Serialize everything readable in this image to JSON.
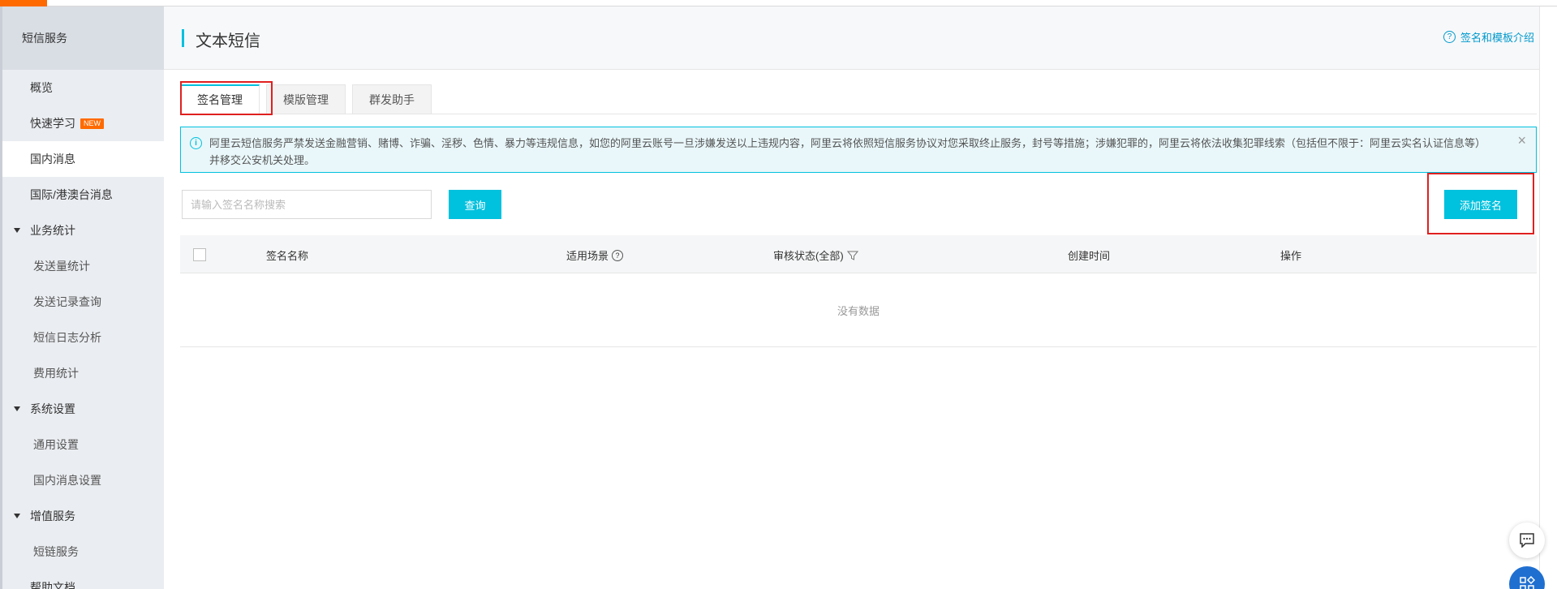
{
  "sidebar": {
    "header": "短信服务",
    "items": [
      {
        "label": "概览",
        "kind": "item"
      },
      {
        "label": "快速学习",
        "kind": "item",
        "badge": "NEW"
      },
      {
        "label": "国内消息",
        "kind": "item",
        "active": true
      },
      {
        "label": "国际/港澳台消息",
        "kind": "item"
      },
      {
        "label": "业务统计",
        "kind": "group"
      },
      {
        "label": "发送量统计",
        "kind": "sub"
      },
      {
        "label": "发送记录查询",
        "kind": "sub"
      },
      {
        "label": "短信日志分析",
        "kind": "sub"
      },
      {
        "label": "费用统计",
        "kind": "sub"
      },
      {
        "label": "系统设置",
        "kind": "group"
      },
      {
        "label": "通用设置",
        "kind": "sub"
      },
      {
        "label": "国内消息设置",
        "kind": "sub"
      },
      {
        "label": "增值服务",
        "kind": "group"
      },
      {
        "label": "短链服务",
        "kind": "sub"
      },
      {
        "label": "帮助文档",
        "kind": "item"
      }
    ]
  },
  "header": {
    "title": "文本短信",
    "help_link": "签名和模板介绍"
  },
  "tabs": [
    {
      "label": "签名管理",
      "active": true
    },
    {
      "label": "模版管理",
      "active": false
    },
    {
      "label": "群发助手",
      "active": false
    }
  ],
  "notice": {
    "text": "阿里云短信服务严禁发送金融营销、赌博、诈骗、淫秽、色情、暴力等违规信息，如您的阿里云账号一旦涉嫌发送以上违规内容，阿里云将依照短信服务协议对您采取终止服务，封号等措施；涉嫌犯罪的，阿里云将依法收集犯罪线索（包括但不限于：阿里云实名认证信息等）并移交公安机关处理。"
  },
  "search": {
    "placeholder": "请输入签名名称搜索",
    "query_label": "查询",
    "add_label": "添加签名"
  },
  "table": {
    "columns": [
      "签名名称",
      "适用场景",
      "审核状态(全部)",
      "创建时间",
      "操作"
    ],
    "empty_text": "没有数据"
  },
  "colors": {
    "accent": "#00c1de",
    "brand_orange": "#ff6a00",
    "highlight_red": "#e02020",
    "link_blue": "#0099cc"
  }
}
